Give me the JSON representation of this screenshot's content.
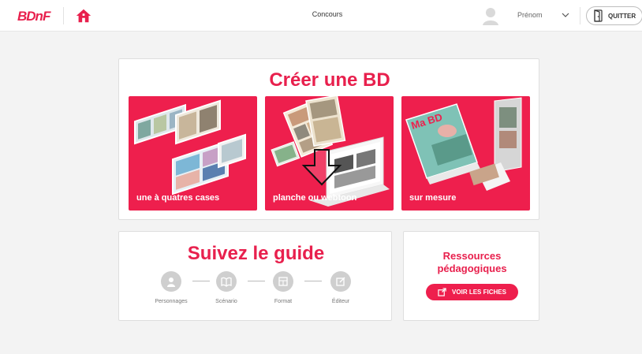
{
  "header": {
    "logo_text": "BDnF",
    "nav_item": "Concours",
    "user_name": "Prénom",
    "quit_label": "QUITTER"
  },
  "create": {
    "title": "Créer une BD",
    "tiles": [
      {
        "label": "une à quatres cases"
      },
      {
        "label": "planche ou webtoon"
      },
      {
        "label": "sur mesure"
      }
    ],
    "book_cover_text": "Ma BD"
  },
  "guide": {
    "title": "Suivez le guide",
    "steps": [
      {
        "label": "Personnages",
        "icon": "character-icon"
      },
      {
        "label": "Scénario",
        "icon": "book-icon"
      },
      {
        "label": "Format",
        "icon": "format-icon"
      },
      {
        "label": "Éditeur",
        "icon": "edit-icon"
      }
    ]
  },
  "resources": {
    "title_line1": "Ressources",
    "title_line2": "pédagogiques",
    "button_label": "VOIR LES FICHES"
  },
  "colors": {
    "brand": "#e8204d",
    "tile_bg": "#ee1f4d",
    "step_gray": "#cfcfcf"
  }
}
